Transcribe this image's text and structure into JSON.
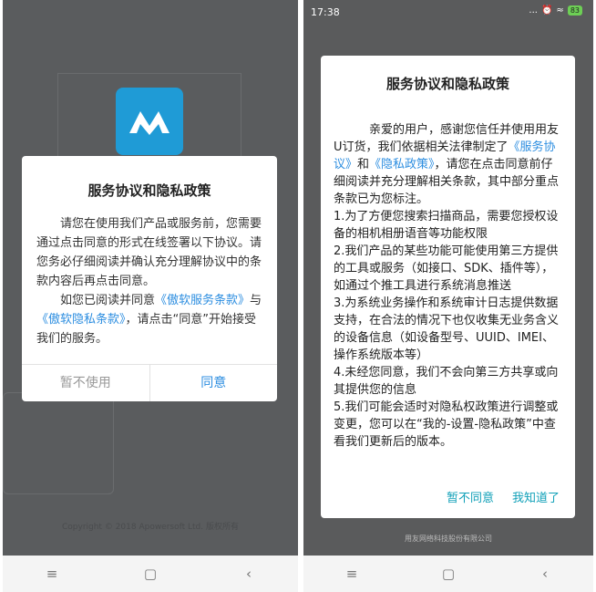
{
  "left": {
    "copyright": "Copyright © 2018 Apowersoft Ltd. 版权所有",
    "dialog": {
      "title": "服务协议和隐私政策",
      "p1": "请您在使用我们产品或服务前，您需要通过点击同意的形式在线签署以下协议。请您务必仔细阅读并确认充分理解协议中的条款内容后再点击同意。",
      "p2_a": "如您已阅读并同意",
      "p2_link1": "《傲软服务条款》",
      "p2_b": "与",
      "p2_link2": "《傲软隐私条款》",
      "p2_c": "，请点击“同意”开始接受我们的服务。",
      "decline": "暂不使用",
      "agree": "同意"
    },
    "nav": {
      "menu": "≡",
      "home": "▢",
      "back": "‹"
    }
  },
  "right": {
    "status": {
      "time": "17:38",
      "signal": "...",
      "battery": "83"
    },
    "dialog": {
      "title": "服务协议和隐私政策",
      "intro_a": "亲爱的用户，感谢您信任并使用用友U订货，我们依据相关法律制定了",
      "intro_link1": "《服务协议》",
      "intro_b": "和",
      "intro_link2": "《隐私政策》",
      "intro_c": "，请您在点击同意前仔细阅读并充分理解相关条款，其中部分重点条款已为您标注。",
      "item1": "1.为了方便您搜索扫描商品，需要您授权设备的相机相册语音等功能权限",
      "item2": "2.我们产品的某些功能可能使用第三方提供的工具或服务（如接口、SDK、插件等），如通过个推工具进行系统消息推送",
      "item3": "3.为系统业务操作和系统审计日志提供数据支持，在合法的情况下也仅收集无业务含义的设备信息（如设备型号、UUID、IMEI、操作系统版本等）",
      "item4": "4.未经您同意，我们不会向第三方共享或向其提供您的信息",
      "item5": "5.我们可能会适时对隐私权政策进行调整或变更，您可以在“我的-设置-隐私政策”中查看我们更新后的版本。",
      "decline": "暂不同意",
      "agree": "我知道了"
    },
    "behind_text": "用友网络科技股份有限公司",
    "nav": {
      "menu": "≡",
      "home": "▢",
      "back": "‹"
    }
  }
}
